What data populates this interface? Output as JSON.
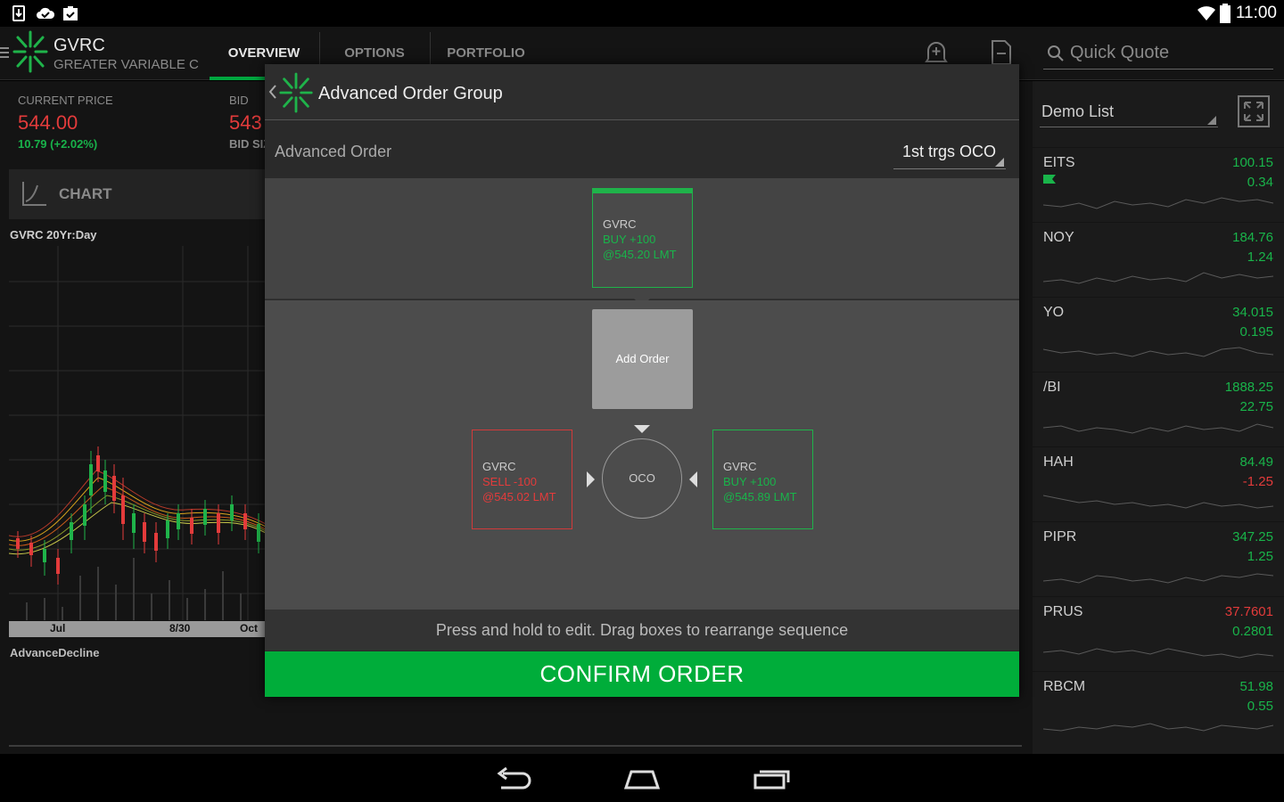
{
  "status_bar": {
    "time": "11:00"
  },
  "header": {
    "symbol": "GVRC",
    "company": "GREATER VARIABLE C",
    "tabs": [
      {
        "label": "OVERVIEW",
        "active": true
      },
      {
        "label": "OPTIONS",
        "active": false
      },
      {
        "label": "PORTFOLIO",
        "active": false
      }
    ],
    "quick_quote_placeholder": "Quick Quote"
  },
  "overview": {
    "current_price_label": "CURRENT PRICE",
    "current_price": "544.00",
    "change": "10.79 (+2.02%)",
    "bid_label": "BID",
    "bid_value": "543",
    "bid_size_label": "BID SIZ",
    "chart_button_label": "CHART",
    "chart_title": "GVRC 20Yr:Day",
    "x_ticks": [
      "Jul",
      "8/30",
      "Oct"
    ],
    "indicator_label": "AdvanceDecline"
  },
  "watchlist": {
    "name": "Demo List",
    "rows": [
      {
        "symbol": "EITS",
        "last": "100.15",
        "change": "0.34",
        "direction": "up",
        "flag": true
      },
      {
        "symbol": "NOY",
        "last": "184.76",
        "change": "1.24",
        "direction": "up",
        "flag": false
      },
      {
        "symbol": "YO",
        "last": "34.015",
        "change": "0.195",
        "direction": "up",
        "flag": false
      },
      {
        "symbol": "/BI",
        "last": "1888.25",
        "change": "22.75",
        "direction": "up",
        "flag": false
      },
      {
        "symbol": "HAH",
        "last": "84.49",
        "change": "-1.25",
        "direction": "mixed",
        "flag": false
      },
      {
        "symbol": "PIPR",
        "last": "347.25",
        "change": "1.25",
        "direction": "up",
        "flag": false
      },
      {
        "symbol": "PRUS",
        "last": "37.7601",
        "change": "0.2801",
        "direction": "mixed-red",
        "flag": false
      },
      {
        "symbol": "RBCM",
        "last": "51.98",
        "change": "0.55",
        "direction": "up",
        "flag": false
      }
    ]
  },
  "dialog": {
    "title": "Advanced Order Group",
    "advanced_order_label": "Advanced Order",
    "advanced_order_value": "1st trgs OCO",
    "trigger_order": {
      "symbol": "GVRC",
      "action": "BUY +100",
      "price": "@545.20 LMT"
    },
    "add_order_label": "Add Order",
    "oco_label": "OCO",
    "oco_left": {
      "symbol": "GVRC",
      "action": "SELL -100",
      "price": "@545.02 LMT"
    },
    "oco_right": {
      "symbol": "GVRC",
      "action": "BUY +100",
      "price": "@545.89 LMT"
    },
    "hint": "Press and hold to edit. Drag boxes to rearrange sequence",
    "confirm_label": "CONFIRM ORDER"
  },
  "colors": {
    "accent_green": "#00ad3a",
    "down_red": "#e33b3b",
    "up_green": "#19b44a"
  }
}
